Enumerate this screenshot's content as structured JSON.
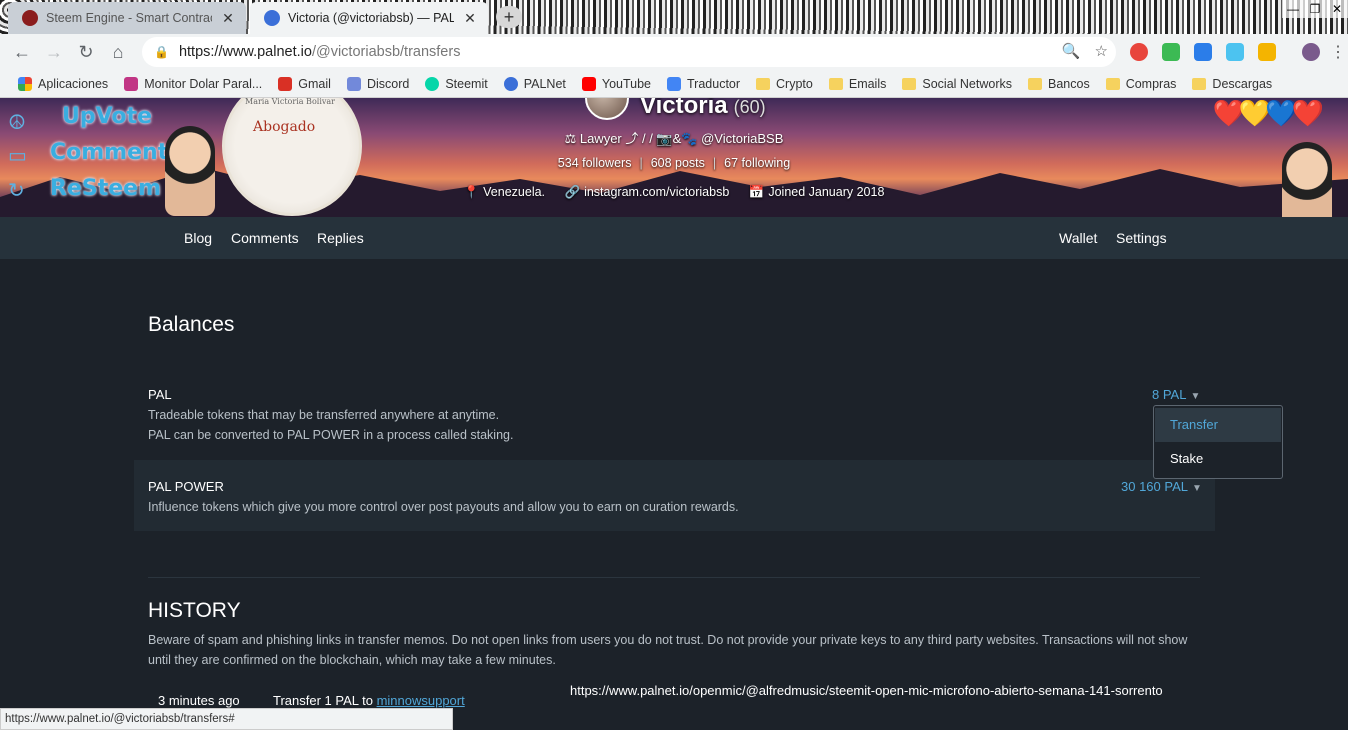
{
  "browser": {
    "tabs": [
      {
        "title": "Steem Engine - Smart Contracts",
        "favicon": "steem-engine-icon",
        "active": false
      },
      {
        "title": "Victoria (@victoriabsb) — PALNet",
        "favicon": "palnet-icon",
        "active": true
      }
    ],
    "new_tab_label": "+",
    "url_host": "https://www.palnet.io",
    "url_path": "/@victoriabsb/transfers",
    "bookmarks": [
      {
        "label": "Aplicaciones",
        "icon": "apps-grid-icon",
        "color": "#4285f4"
      },
      {
        "label": "Monitor Dolar Paral...",
        "icon": "instagram-icon",
        "color": "#c13584"
      },
      {
        "label": "Gmail",
        "icon": "gmail-icon",
        "color": "#d93025"
      },
      {
        "label": "Discord",
        "icon": "discord-icon",
        "color": "#7289da"
      },
      {
        "label": "Steemit",
        "icon": "steemit-icon",
        "color": "#06d6a9"
      },
      {
        "label": "PALNet",
        "icon": "palnet-icon",
        "color": "#3b6fd8"
      },
      {
        "label": "YouTube",
        "icon": "youtube-icon",
        "color": "#ff0000"
      },
      {
        "label": "Traductor",
        "icon": "translate-icon",
        "color": "#4285f4"
      },
      {
        "label": "Crypto",
        "icon": "folder-icon"
      },
      {
        "label": "Emails",
        "icon": "folder-icon"
      },
      {
        "label": "Social Networks",
        "icon": "folder-icon"
      },
      {
        "label": "Bancos",
        "icon": "folder-icon"
      },
      {
        "label": "Compras",
        "icon": "folder-icon"
      },
      {
        "label": "Descargas",
        "icon": "folder-icon"
      }
    ],
    "status_url": "https://www.palnet.io/@victoriabsb/transfers#"
  },
  "profile": {
    "name": "Victoria",
    "reputation": "(60)",
    "about": "⚖ Lawyer ⤴ / / 📷&🐾 @VictoriaBSB",
    "followers": "534 followers",
    "posts": "608 posts",
    "following": "67 following",
    "location": "Venezuela.",
    "website": "instagram.com/victoriabsb",
    "joined": "Joined January 2018",
    "cover_stickers": [
      "UpVote",
      "Comment",
      "ReSteem"
    ],
    "cover_disc_label": "Abogado",
    "cover_disc_sub": "María Victoria Bolivar"
  },
  "subnav": {
    "blog": "Blog",
    "comments": "Comments",
    "replies": "Replies",
    "wallet": "Wallet",
    "settings": "Settings"
  },
  "balances": {
    "title": "Balances",
    "pal": {
      "name": "PAL",
      "desc1": "Tradeable tokens that may be transferred anywhere at anytime.",
      "desc2": "PAL can be converted to PAL POWER in a process called staking.",
      "value": "8 PAL"
    },
    "pal_power": {
      "name": "PAL POWER",
      "desc": "Influence tokens which give you more control over post payouts and allow you to earn on curation rewards.",
      "value": "30 160 PAL"
    },
    "dropdown": {
      "transfer": "Transfer",
      "stake": "Stake"
    }
  },
  "history": {
    "title": "HISTORY",
    "warning": "Beware of spam and phishing links in transfer memos. Do not open links from users you do not trust. Do not provide your private keys to any third party websites. Transactions will not show until they are confirmed on the blockchain, which may take a few minutes.",
    "rows": [
      {
        "time": "3 minutes ago",
        "action": "Transfer 1 PAL to ",
        "user": "minnowsupport",
        "memo": "https://www.palnet.io/openmic/@alfredmusic/steemit-open-mic-microfono-abierto-semana-141-sorrento"
      }
    ]
  },
  "colors": {
    "accent": "#51a7d8",
    "page_bg": "#1c2229",
    "nav_bg": "#26323b"
  }
}
